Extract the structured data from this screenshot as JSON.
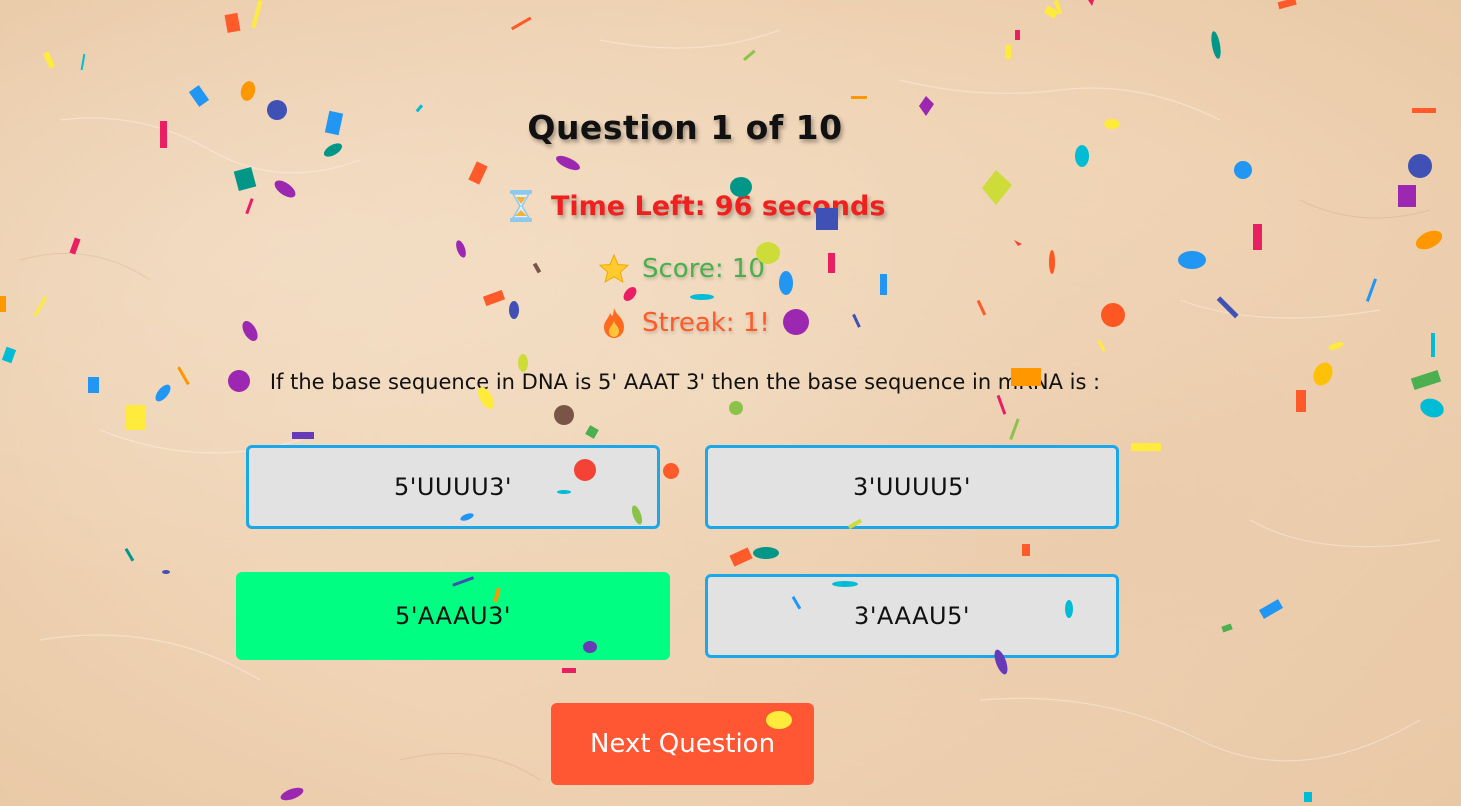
{
  "quiz": {
    "question_count": "Question 1 of 10",
    "timer_text": "Time Left: 96 seconds",
    "score_text": "Score: 10",
    "streak_text": "Streak: 1!",
    "question": "If the base sequence in DNA is 5' AAAT 3' then the base sequence in mRNA is :",
    "options": [
      {
        "label": "5'UUUU3'",
        "state": "default"
      },
      {
        "label": "3'UUUU5'",
        "state": "default"
      },
      {
        "label": "5'AAAU3'",
        "state": "correct"
      },
      {
        "label": "3'AAAU5'",
        "state": "default"
      }
    ],
    "next_label": "Next Question"
  },
  "icons": {
    "timer": "hourglass-icon",
    "score": "star-icon",
    "streak": "fire-icon"
  },
  "colors": {
    "timer": "#f0201e",
    "score": "#48b04c",
    "streak": "#ff5a2a",
    "option_border": "#1aa8ea",
    "option_bg": "#e2e2e2",
    "correct_bg": "#00fe82",
    "next_button": "#ff5733"
  }
}
